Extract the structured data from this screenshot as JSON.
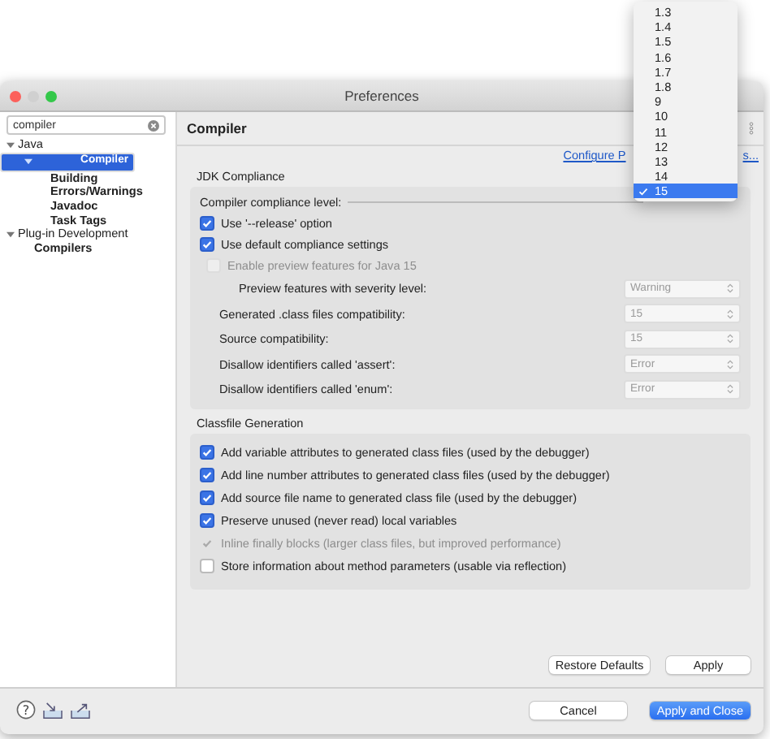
{
  "window": {
    "title": "Preferences"
  },
  "sidebar": {
    "search": {
      "value": "compiler"
    },
    "tree": [
      {
        "label": "Java",
        "matched": false,
        "selected": false,
        "expanded": true,
        "children": [
          {
            "label": "Compiler",
            "matched": true,
            "selected": true,
            "expanded": true,
            "children": [
              {
                "label": "Building",
                "matched": true,
                "selected": false
              },
              {
                "label": "Errors/Warnings",
                "matched": true,
                "selected": false
              },
              {
                "label": "Javadoc",
                "matched": true,
                "selected": false
              },
              {
                "label": "Task Tags",
                "matched": true,
                "selected": false
              }
            ]
          }
        ]
      },
      {
        "label": "Plug-in Development",
        "matched": false,
        "selected": false,
        "expanded": true,
        "children": [
          {
            "label": "Compilers",
            "matched": true,
            "selected": false
          }
        ]
      }
    ]
  },
  "page": {
    "title": "Compiler",
    "link_parts": [
      "Configure P",
      "s..."
    ],
    "jdk": {
      "label": "JDK Compliance",
      "rows": [
        {
          "kind": "label",
          "label": "Compiler compliance level:"
        },
        {
          "kind": "checkbox",
          "label": "Use '--release' option",
          "checked": true,
          "disabled": false
        },
        {
          "kind": "checkbox",
          "label": "Use default compliance settings",
          "checked": true,
          "disabled": false
        },
        {
          "kind": "sub-checkbox",
          "label": "Enable preview features for Java 15",
          "checked": false,
          "disabled": true
        },
        {
          "kind": "sub-select",
          "label": "Preview features with severity level:",
          "value": "Warning",
          "disabled": true
        },
        {
          "kind": "select",
          "label": "Generated .class files compatibility:",
          "value": "15",
          "disabled": true
        },
        {
          "kind": "select",
          "label": "Source compatibility:",
          "value": "15",
          "disabled": true
        },
        {
          "kind": "select",
          "label": "Disallow identifiers called 'assert':",
          "value": "Error",
          "disabled": true
        },
        {
          "kind": "select",
          "label": "Disallow identifiers called 'enum':",
          "value": "Error",
          "disabled": true
        }
      ]
    },
    "classfile": {
      "label": "Classfile Generation",
      "rows": [
        {
          "label": "Add variable attributes to generated class files (used by the debugger)",
          "checked": true,
          "disabled": false
        },
        {
          "label": "Add line number attributes to generated class files (used by the debugger)",
          "checked": true,
          "disabled": false
        },
        {
          "label": "Add source file name to generated class file (used by the debugger)",
          "checked": true,
          "disabled": false
        },
        {
          "label": "Preserve unused (never read) local variables",
          "checked": true,
          "disabled": false
        },
        {
          "label": "Inline finally blocks (larger class files, but improved performance)",
          "checked": true,
          "disabled": true
        },
        {
          "label": "Store information about method parameters (usable via reflection)",
          "checked": false,
          "disabled": false
        }
      ]
    },
    "buttons": [
      {
        "label": "Restore Defaults"
      },
      {
        "label": "Apply"
      }
    ]
  },
  "footer": {
    "help_glyph": "?",
    "buttons": [
      {
        "label": "Cancel",
        "kind": "normal"
      },
      {
        "label": "Apply and Close",
        "kind": "primary"
      }
    ]
  },
  "dropdown": {
    "options": [
      {
        "label": "1.3",
        "selected": false
      },
      {
        "label": "1.4",
        "selected": false
      },
      {
        "label": "1.5",
        "selected": false
      },
      {
        "label": "1.6",
        "selected": false
      },
      {
        "label": "1.7",
        "selected": false
      },
      {
        "label": "1.8",
        "selected": false
      },
      {
        "label": "9",
        "selected": false
      },
      {
        "label": "10",
        "selected": false
      },
      {
        "label": "11",
        "selected": false
      },
      {
        "label": "12",
        "selected": false
      },
      {
        "label": "13",
        "selected": false
      },
      {
        "label": "14",
        "selected": false
      },
      {
        "label": "15",
        "selected": true
      }
    ]
  }
}
